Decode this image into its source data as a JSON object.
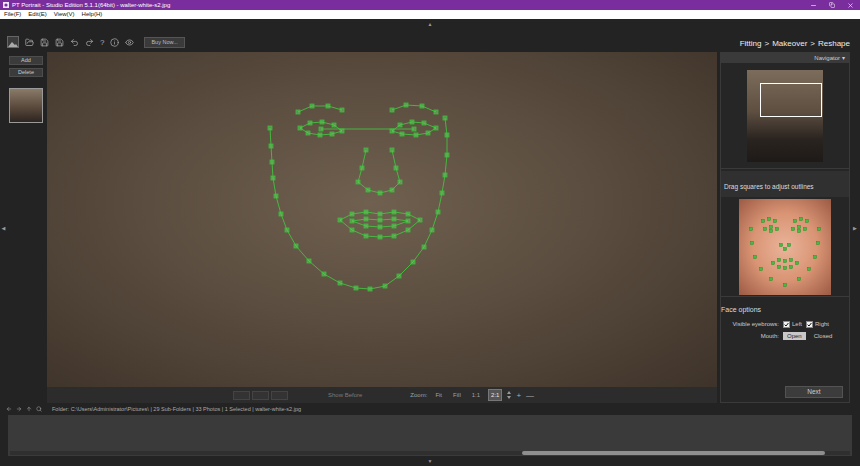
{
  "window": {
    "title": "PT Portrait - Studio Edition 5.1.1(64bit) - walter-white-s2.jpg"
  },
  "menu": [
    "File(F)",
    "Edit(E)",
    "View(V)",
    "Help(H)"
  ],
  "toolbar": {
    "help_glyph": "?",
    "buy_button": "Buy Now..."
  },
  "breadcrumb": {
    "steps": [
      "Fitting",
      "Makeover",
      "Reshape"
    ],
    "separator": ">"
  },
  "collapse_arrows": {
    "top": "▲",
    "bottom": "▼",
    "left": "◀",
    "right": "▶"
  },
  "photos_panel": {
    "buttons": [
      "Add",
      "Delete"
    ],
    "thumbnails": [
      {
        "selected": true
      }
    ]
  },
  "canvas": {
    "show_before": {
      "label": "Show Before",
      "disabled": true
    },
    "zoom": {
      "label": "Zoom:",
      "options": [
        {
          "label": "Fit",
          "selected": false
        },
        {
          "label": "Fill",
          "selected": false
        },
        {
          "label": "1:1",
          "selected": false
        },
        {
          "label": "2:1",
          "selected": true
        }
      ],
      "zoom_in": "+",
      "zoom_out": "—"
    }
  },
  "navigator": {
    "title": "Navigator",
    "menu_glyph": "▾"
  },
  "outline_hint": "Drag squares to adjust outlines",
  "face_options": {
    "title": "Face options",
    "eyebrows": {
      "label": "Visible eyebrows:",
      "options": [
        {
          "label": "Left",
          "checked": true
        },
        {
          "label": "Right",
          "checked": true
        }
      ]
    },
    "mouth": {
      "label": "Mouth:",
      "options": [
        {
          "label": "Open",
          "selected": true
        },
        {
          "label": "Closed",
          "selected": false
        }
      ]
    }
  },
  "next_button": "Next",
  "status_bar": {
    "folder": "Folder: C:\\Users\\Administrator\\Pictures\\",
    "separator": "|",
    "parts": [
      "29 Sub-Folders",
      "33 Photos",
      "1 Selected",
      "walter-white-s2.jpg"
    ]
  },
  "filmstrip": {
    "scrollbar": {
      "offset": 0.61,
      "level": 0.36
    }
  }
}
